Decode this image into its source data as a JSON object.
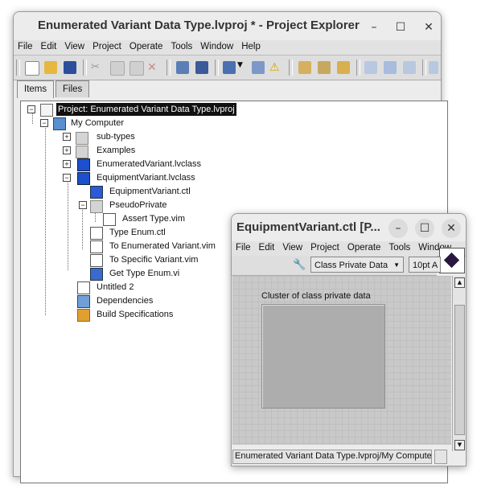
{
  "main_window": {
    "title": "Enumerated Variant Data Type.lvproj * - Project Explorer",
    "menu": [
      "File",
      "Edit",
      "View",
      "Project",
      "Operate",
      "Tools",
      "Window",
      "Help"
    ],
    "tabs": [
      "Items",
      "Files"
    ],
    "tree": [
      {
        "label": "Project: Enumerated Variant Data Type.lvproj",
        "selected": true,
        "icon": "project-icon"
      },
      {
        "label": "My Computer",
        "icon": "computer-icon"
      },
      {
        "label": "sub-types",
        "icon": "folder-icon"
      },
      {
        "label": "Examples",
        "icon": "folder-icon"
      },
      {
        "label": "EnumeratedVariant.lvclass",
        "icon": "class-cube-icon"
      },
      {
        "label": "EquipmentVariant.lvclass",
        "icon": "class-cube-icon"
      },
      {
        "label": "EquipmentVariant.ctl",
        "icon": "control-icon"
      },
      {
        "label": "PseudoPrivate",
        "icon": "folder-icon"
      },
      {
        "label": "Assert Type.vim",
        "icon": "vim-icon"
      },
      {
        "label": "Type Enum.ctl",
        "icon": "ctl-icon"
      },
      {
        "label": "To Enumerated Variant.vim",
        "icon": "vim-icon"
      },
      {
        "label": "To Specific Variant.vim",
        "icon": "vim-icon"
      },
      {
        "label": "Get Type Enum.vi",
        "icon": "vi-icon"
      },
      {
        "label": "Untitled 2",
        "icon": "vi-icon"
      },
      {
        "label": "Dependencies",
        "icon": "dependencies-icon"
      },
      {
        "label": "Build Specifications",
        "icon": "build-icon"
      }
    ]
  },
  "ctl_window": {
    "title": "EquipmentVariant.ctl [P...",
    "menu": [
      "File",
      "Edit",
      "View",
      "Project",
      "Operate",
      "Tools",
      "Window"
    ],
    "scope_select": "Class Private Data",
    "font_select": "10pt A",
    "cluster_label": "Cluster of class private data",
    "status_path": "Enumerated Variant Data Type.lvproj/My Computer"
  },
  "colors": {
    "selection": "#111111",
    "window_bg": "#ececec",
    "grid": "#c9c9c9",
    "cluster": "#adadad"
  }
}
